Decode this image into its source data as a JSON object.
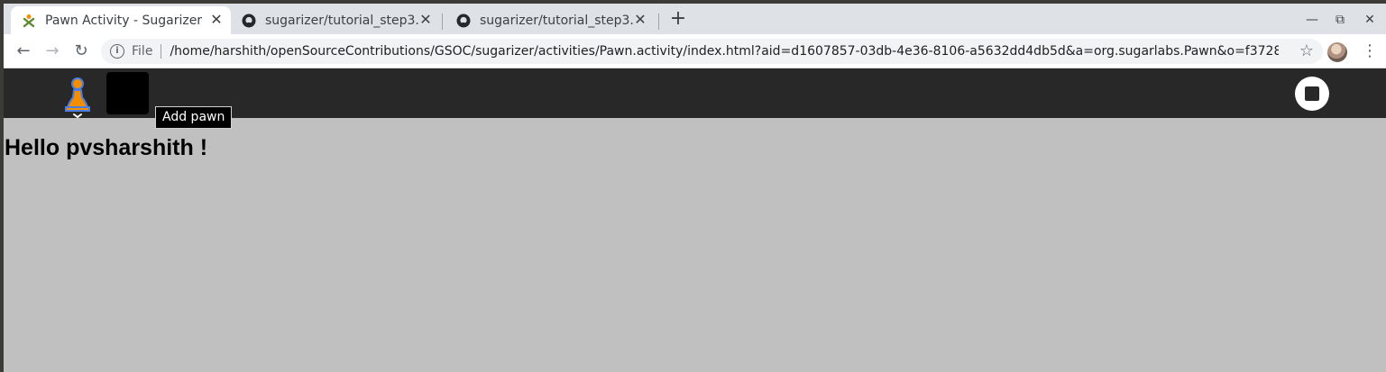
{
  "tabs": [
    {
      "title": "Pawn Activity - Sugarizer",
      "icon": "sugarizer-icon",
      "active": true
    },
    {
      "title": "sugarizer/tutorial_step3.",
      "icon": "github-icon",
      "active": false
    },
    {
      "title": "sugarizer/tutorial_step3.",
      "icon": "github-icon",
      "active": false
    }
  ],
  "close_glyph": "✕",
  "new_tab_glyph": "+",
  "window_controls": {
    "minimize": "—",
    "restore": "⧉",
    "close": "✕"
  },
  "nav": {
    "back": "←",
    "forward": "→",
    "reload": "↻"
  },
  "omnibox": {
    "info_glyph": "i",
    "scheme": "File",
    "url": "/home/harshith/openSourceContributions/GSOC/sugarizer/activities/Pawn.activity/index.html?aid=d1607857-03db-4e36-8106-a5632dd4db5d&a=org.sugarlabs.Pawn&o=f3728b25-d0fc-4a3d-be..."
  },
  "star_glyph": "☆",
  "menu_glyph": "⋮",
  "activity": {
    "tooltip": "Add pawn",
    "greeting": "Hello pvsharshith !",
    "colors": {
      "toolbar": "#282828",
      "canvas": "#c0c0c0",
      "pawn_fill": "#f28e00",
      "pawn_stroke": "#4a7ee0"
    }
  }
}
